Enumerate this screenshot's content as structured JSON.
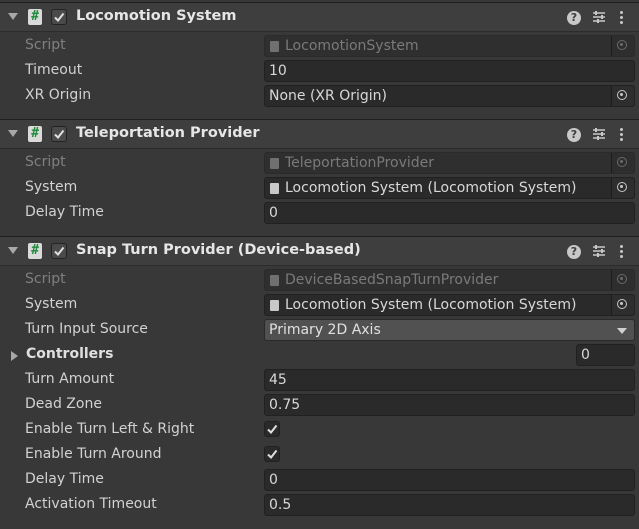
{
  "components": [
    {
      "title": "Locomotion System",
      "script_label": "Script",
      "script_value": "LocomotionSystem",
      "fields": [
        {
          "label": "Timeout",
          "value": "10"
        },
        {
          "label": "XR Origin",
          "value": "None (XR Origin)"
        }
      ]
    },
    {
      "title": "Teleportation Provider",
      "script_label": "Script",
      "script_value": "TeleportationProvider",
      "fields": [
        {
          "label": "System",
          "value": "Locomotion System (Locomotion System)"
        },
        {
          "label": "Delay Time",
          "value": "0"
        }
      ]
    },
    {
      "title": "Snap Turn Provider (Device-based)",
      "script_label": "Script",
      "script_value": "DeviceBasedSnapTurnProvider",
      "fields": [
        {
          "label": "System",
          "value": "Locomotion System (Locomotion System)"
        },
        {
          "label": "Turn Input Source",
          "value": "Primary 2D Axis"
        },
        {
          "label": "Controllers",
          "value": "0"
        },
        {
          "label": "Turn Amount",
          "value": "45"
        },
        {
          "label": "Dead Zone",
          "value": "0.75"
        },
        {
          "label": "Enable Turn Left & Right",
          "checked": true
        },
        {
          "label": "Enable Turn Around",
          "checked": true
        },
        {
          "label": "Delay Time",
          "value": "0"
        },
        {
          "label": "Activation Timeout",
          "value": "0.5"
        }
      ]
    }
  ],
  "header_buttons": {
    "help": "?"
  },
  "icons": {
    "script_icon": "#",
    "colors": {
      "accent": "#1e8a3a",
      "panel": "#383838",
      "header": "#3e3e3e"
    }
  }
}
